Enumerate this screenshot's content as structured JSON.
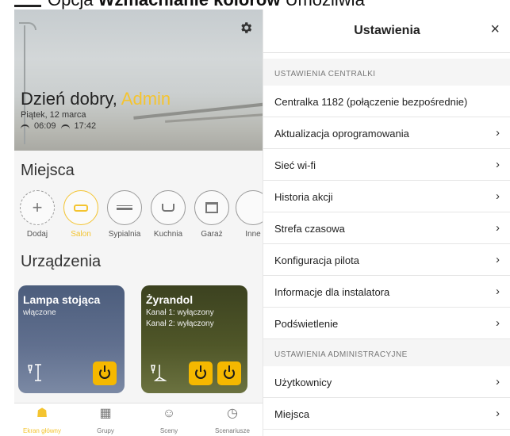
{
  "caption": {
    "prefix": "Opcja",
    "bold": "Wzmacnianie kolorów",
    "suffix": "Umożliwia"
  },
  "left": {
    "greeting": "Dzień dobry,",
    "user": "Admin",
    "date": "Piątek, 12 marca",
    "sunrise": "06:09",
    "sunset": "17:42",
    "places_title": "Miejsca",
    "places": [
      {
        "label": "Dodaj",
        "icon": "plus-icon"
      },
      {
        "label": "Salon",
        "icon": "sofa-icon"
      },
      {
        "label": "Sypialnia",
        "icon": "bed-icon"
      },
      {
        "label": "Kuchnia",
        "icon": "pot-icon"
      },
      {
        "label": "Garaż",
        "icon": "garage-icon"
      },
      {
        "label": "Inne",
        "icon": "other-icon"
      }
    ],
    "devices_title": "Urządzenia",
    "devices": [
      {
        "name": "Lampa stojąca",
        "status": "włączone",
        "icon": "floor-lamp-icon"
      },
      {
        "name": "Żyrandol",
        "status1": "Kanał 1: wyłączony",
        "status2": "Kanał 2: wyłączony",
        "icon": "chandelier-icon"
      }
    ],
    "nav": [
      {
        "label": "Ekran główny",
        "icon": "home-icon"
      },
      {
        "label": "Grupy",
        "icon": "grid-icon"
      },
      {
        "label": "Sceny",
        "icon": "mask-icon"
      },
      {
        "label": "Scenariusze",
        "icon": "clock-icon"
      }
    ]
  },
  "right": {
    "title": "Ustawienia",
    "close": "×",
    "section1": "USTAWIENIA CENTRALKI",
    "items1": [
      "Centralka 1182 (połączenie bezpośrednie)",
      "Aktualizacja oprogramowania",
      "Sieć wi-fi",
      "Historia akcji",
      "Strefa czasowa",
      "Konfiguracja pilota",
      "Informacje dla instalatora",
      "Podświetlenie"
    ],
    "section2": "USTAWIENIA ADMINISTRACYJNE",
    "items2": [
      "Użytkownicy",
      "Miejsca"
    ]
  },
  "colors": {
    "accent": "#f4c430",
    "lamp_card": "#5a6a88",
    "chandelier_card": "#4a5126",
    "power": "#f5b800"
  }
}
